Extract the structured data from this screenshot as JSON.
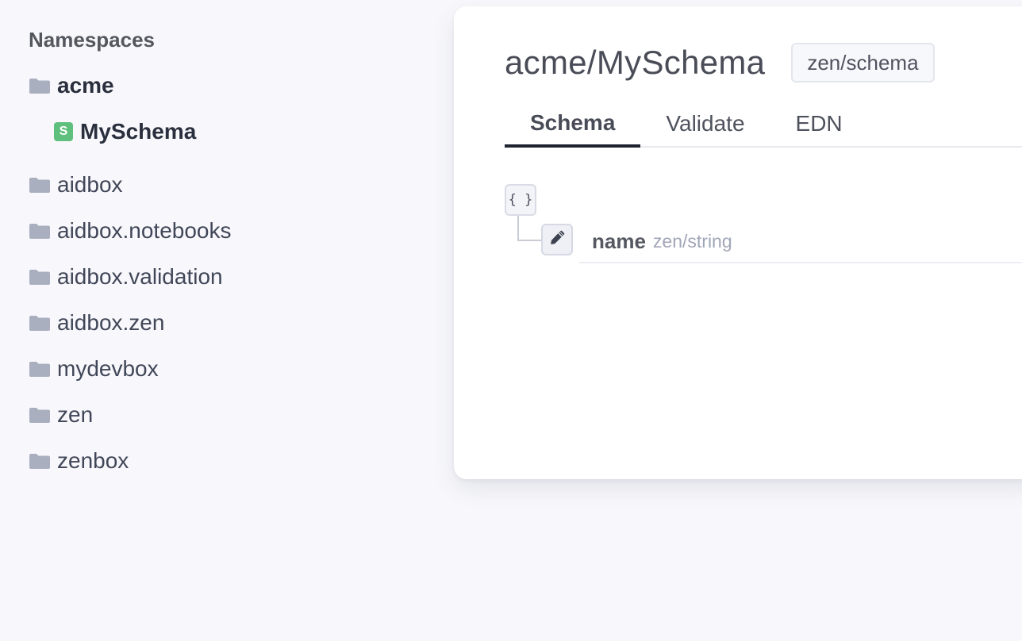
{
  "sidebar": {
    "title": "Namespaces",
    "namespaces": [
      {
        "label": "acme",
        "icon": "folder-icon",
        "active": true,
        "children": [
          {
            "label": "MySchema",
            "badge": "S",
            "icon": "schema-badge-icon"
          }
        ]
      },
      {
        "label": "aidbox",
        "icon": "folder-icon"
      },
      {
        "label": "aidbox.notebooks",
        "icon": "folder-icon"
      },
      {
        "label": "aidbox.validation",
        "icon": "folder-icon"
      },
      {
        "label": "aidbox.zen",
        "icon": "folder-icon"
      },
      {
        "label": "mydevbox",
        "icon": "folder-icon"
      },
      {
        "label": "zen",
        "icon": "folder-icon"
      },
      {
        "label": "zenbox",
        "icon": "folder-icon"
      }
    ]
  },
  "main": {
    "title": "acme/MySchema",
    "tag": "zen/schema",
    "tabs": [
      {
        "label": "Schema",
        "active": true
      },
      {
        "label": "Validate"
      },
      {
        "label": "EDN"
      }
    ],
    "schema": {
      "root_icon": "{ }",
      "fields": [
        {
          "name": "name",
          "type": "zen/string",
          "icon": "pencil-icon"
        }
      ]
    }
  },
  "colors": {
    "background": "#f8f8fc",
    "folder": "#a9afbf",
    "schema_badge": "#5fbf7c",
    "active_tab_underline": "#1f2330",
    "field_type": "#a0a6b8"
  }
}
